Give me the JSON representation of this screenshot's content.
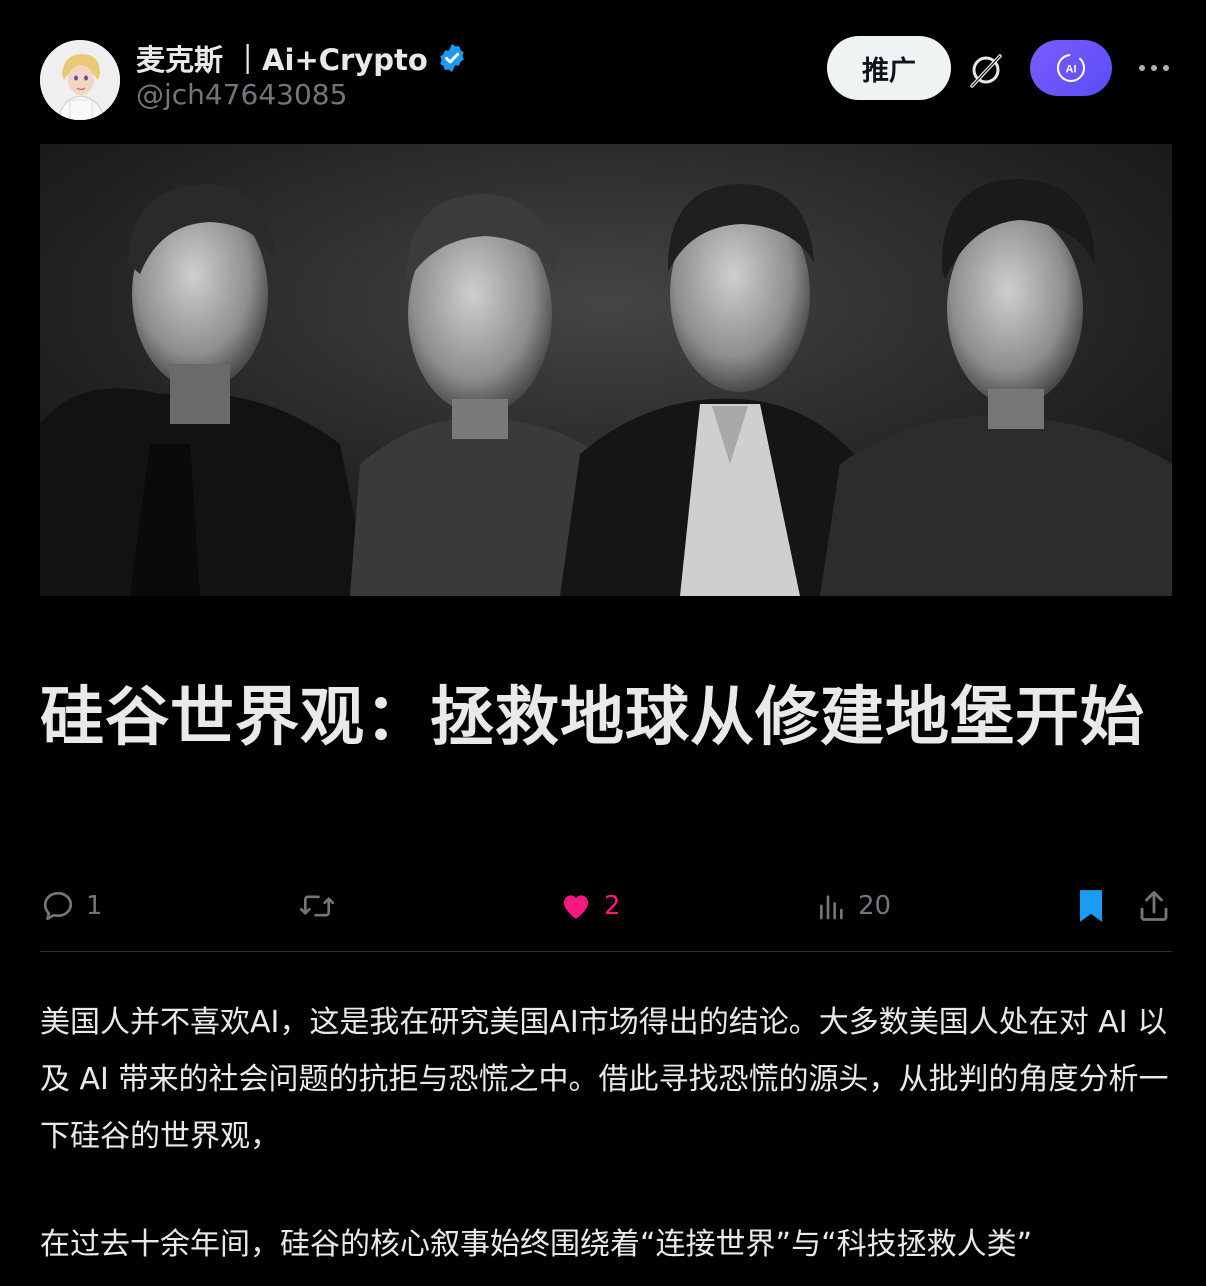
{
  "author": {
    "display_name": "麦克斯 ｜Ai+Crypto",
    "handle": "@jch47643085",
    "verified": true
  },
  "header_actions": {
    "promote_label": "推广",
    "ai_label": "AI"
  },
  "icons": {
    "verified": "verified-badge-icon",
    "grok": "grok-icon",
    "ai": "ai-assistant-icon",
    "more": "more-icon",
    "reply": "reply-icon",
    "repost": "repost-icon",
    "like": "heart-icon",
    "views": "views-icon",
    "bookmark": "bookmark-icon",
    "share": "share-icon"
  },
  "article": {
    "title": "硅谷世界观：拯救地球从修建地堡开始",
    "paragraphs": [
      "美国人并不喜欢AI，这是我在研究美国AI市场得出的结论。大多数美国人处在对 AI 以及 AI 带来的社会问题的抗拒与恐慌之中。借此寻找恐慌的源头，从批判的角度分析一下硅谷的世界观，",
      "在过去十余年间，硅谷的核心叙事始终围绕着“连接世界”与“科技拯救人类”"
    ]
  },
  "stats": {
    "replies": "1",
    "reposts": "",
    "likes": "2",
    "views": "20"
  },
  "colors": {
    "background": "#000000",
    "text_primary": "#e7e9ea",
    "text_secondary": "#71767b",
    "verified_blue": "#1d9bf0",
    "like_pink": "#f91880",
    "bookmark_blue": "#1d9bf0",
    "ai_button": "#6a55ff",
    "divider": "#2f3336"
  }
}
